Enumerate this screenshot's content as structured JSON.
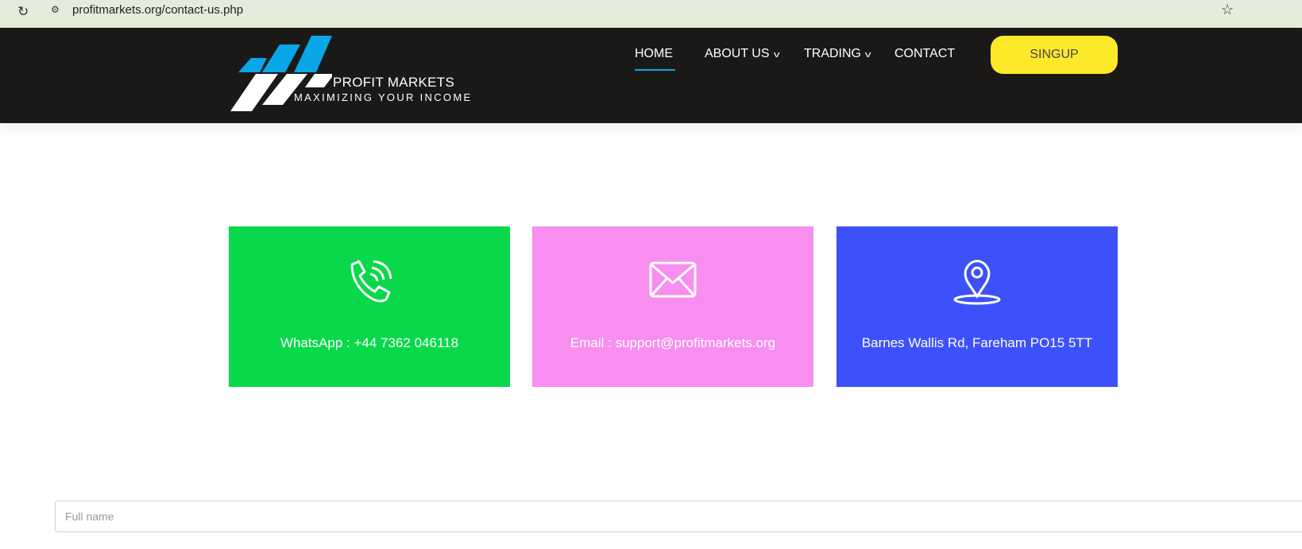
{
  "browser": {
    "url": "profitmarkets.org/contact-us.php"
  },
  "header": {
    "brand": "PROFIT MARKETS",
    "tagline": "MAXIMIZING YOUR INCOME",
    "nav": [
      {
        "label": "HOME"
      },
      {
        "label": "ABOUT US"
      },
      {
        "label": "TRADING"
      },
      {
        "label": "CONTACT"
      }
    ],
    "signup_label": "SINGUP"
  },
  "contact_cards": [
    {
      "text": "WhatsApp : +44 7362 046118",
      "icon": "phone-icon",
      "color": "#08d84a"
    },
    {
      "text": "Email : support@profitmarkets.org",
      "icon": "envelope-icon",
      "color": "#f78ef0"
    },
    {
      "text": "Barnes Wallis Rd, Fareham PO15 5TT",
      "icon": "map-pin-icon",
      "color": "#3d51fb"
    }
  ],
  "form": {
    "fullname_placeholder": "Full name"
  }
}
